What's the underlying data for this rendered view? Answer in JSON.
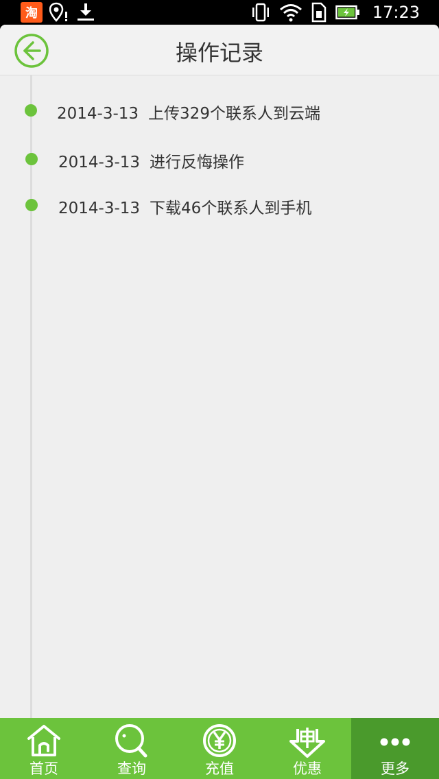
{
  "status_bar": {
    "app_badge": "淘",
    "time": "17:23"
  },
  "header": {
    "title": "操作记录",
    "back_icon": "back-arrow-icon"
  },
  "colors": {
    "accent": "#6cc33c",
    "accent_dark": "#4a9a2c",
    "background": "#efefef"
  },
  "records": [
    {
      "date": "2014-3-13",
      "action": "上传329个联系人到云端"
    },
    {
      "date": "2014-3-13",
      "action": "进行反悔操作"
    },
    {
      "date": "2014-3-13",
      "action": "下载46个联系人到手机"
    }
  ],
  "bottom_nav": {
    "items": [
      {
        "label": "首页",
        "icon": "home-icon"
      },
      {
        "label": "查询",
        "icon": "search-icon"
      },
      {
        "label": "充值",
        "icon": "yuan-icon"
      },
      {
        "label": "优惠",
        "icon": "coupon-icon"
      },
      {
        "label": "更多",
        "icon": "more-icon",
        "active": true
      }
    ]
  }
}
